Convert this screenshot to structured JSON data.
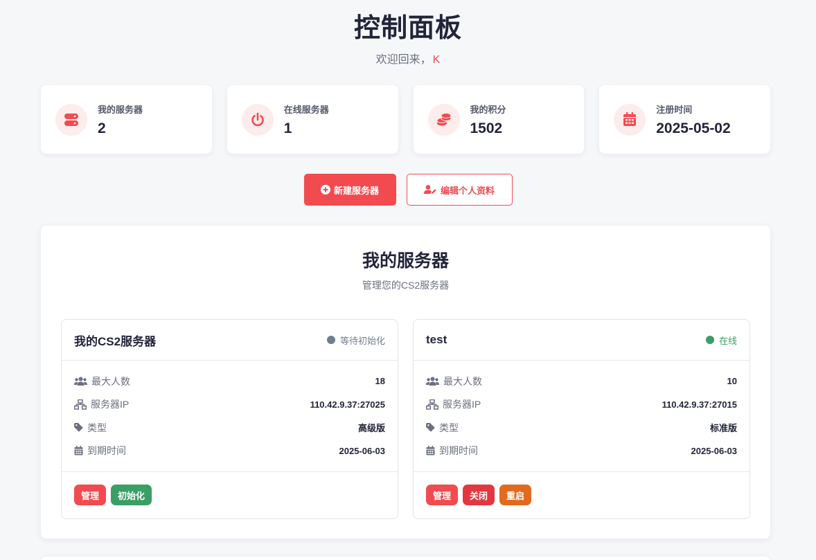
{
  "header": {
    "title": "控制面板",
    "welcome_prefix": "欢迎回来，",
    "username": "K"
  },
  "stats": [
    {
      "label": "我的服务器",
      "value": "2",
      "icon": "server-icon"
    },
    {
      "label": "在线服务器",
      "value": "1",
      "icon": "power-icon"
    },
    {
      "label": "我的积分",
      "value": "1502",
      "icon": "coins-icon"
    },
    {
      "label": "注册时间",
      "value": "2025-05-02",
      "icon": "calendar-icon"
    }
  ],
  "actions": {
    "new_server": "新建服务器",
    "edit_profile": "编辑个人资料"
  },
  "panel": {
    "title": "我的服务器",
    "subtitle": "管理您的CS2服务器"
  },
  "servers": [
    {
      "name": "我的CS2服务器",
      "status": "等待初始化",
      "status_color": "#6f7d91",
      "labels": {
        "max_players": "最大人数",
        "ip": "服务器IP",
        "type": "类型",
        "expire": "到期时间"
      },
      "max_players": "18",
      "ip": "110.42.9.37:27025",
      "type": "高级版",
      "expire": "2025-06-03",
      "buttons": [
        "管理",
        "初始化"
      ]
    },
    {
      "name": "test",
      "status": "在线",
      "status_color": "#3a9e65",
      "labels": {
        "max_players": "最大人数",
        "ip": "服务器IP",
        "type": "类型",
        "expire": "到期时间"
      },
      "max_players": "10",
      "ip": "110.42.9.37:27015",
      "type": "标准版",
      "expire": "2025-06-03",
      "buttons": [
        "管理",
        "关闭",
        "重启"
      ]
    }
  ],
  "colors": {
    "accent": "#f24b4f",
    "success": "#3a9e65",
    "warning": "#e26a1f",
    "muted": "#6f7d91"
  }
}
